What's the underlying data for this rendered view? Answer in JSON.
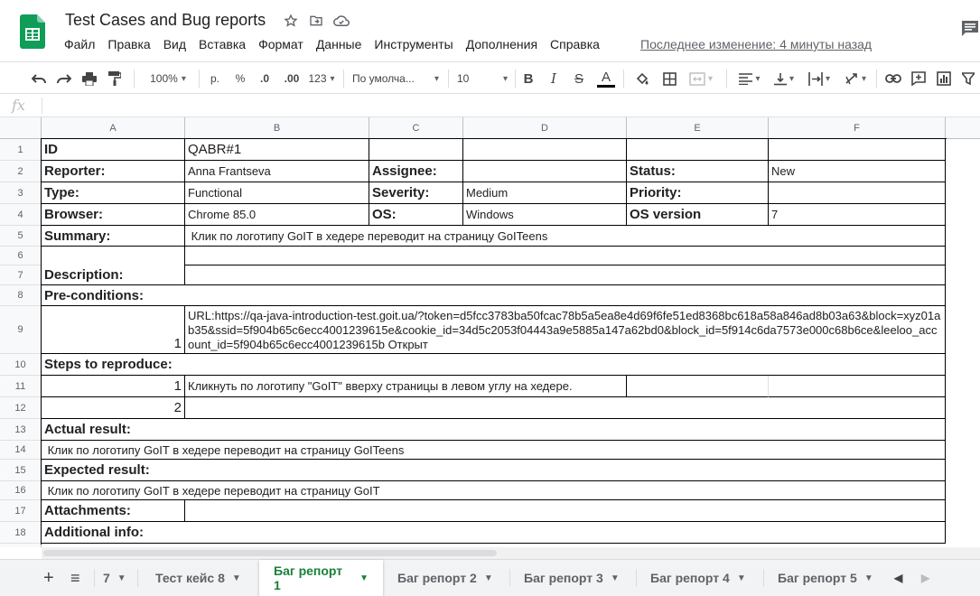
{
  "header": {
    "title": "Test Cases and Bug reports",
    "last_edit": "Последнее изменение: 4 минуты назад",
    "menu": [
      "Файл",
      "Правка",
      "Вид",
      "Вставка",
      "Формат",
      "Данные",
      "Инструменты",
      "Дополнения",
      "Справка"
    ]
  },
  "toolbar": {
    "zoom": "100%",
    "currency": "р.",
    "percent": "%",
    "dec_decrease": ".0",
    "dec_increase": ".00",
    "format_more": "123",
    "font": "По умолча...",
    "font_size": "10",
    "bold": "B",
    "italic": "I",
    "strike": "S",
    "text_color": "A"
  },
  "formula": {
    "fx": "fx",
    "value": ""
  },
  "columns": [
    "A",
    "B",
    "C",
    "D",
    "E",
    "F"
  ],
  "rows": [
    "1",
    "2",
    "3",
    "4",
    "5",
    "6",
    "7",
    "8",
    "9",
    "10",
    "11",
    "12",
    "13",
    "14",
    "15",
    "16",
    "17",
    "18"
  ],
  "cells": {
    "a1": "ID",
    "b1": "QABR#1",
    "a2": "Reporter:",
    "b2": "Anna Frantseva",
    "c2": "Assignee:",
    "e2": "Status:",
    "f2": "New",
    "a3": "Type:",
    "b3": "Functional",
    "c3": "Severity:",
    "d3": "Medium",
    "e3": "Priority:",
    "a4": "Browser:",
    "b4": "Chrome 85.0",
    "c4": "OS:",
    "d4": "Windows",
    "e4": "OS version",
    "f4": "7",
    "a5": "Summary:",
    "b5": " Клик по логотипу GoIT в хедере переводит на страницу GoITeens",
    "a7": "Description:",
    "a8": "Pre-conditions:",
    "a9": "1",
    "b9": "URL:https://qa-java-introduction-test.goit.ua/?token=d5fcc3783ba50fcac78b5a5ea8e4d69f6fe51ed8368bc618a58a846ad8b03a63&block=xyz01ab35&ssid=5f904b65c6ecc4001239615e&cookie_id=34d5c2053f04443a9e5885a147a62bd0&block_id=5f914c6da7573e000c68b6ce&leeloo_account_id=5f904b65c6ecc4001239615b Открыт",
    "a10": "Steps to reproduce:",
    "a11": "1",
    "b11": "Кликнуть по логотипу \"GoIT\" вверху страницы в левом углу на хедере.",
    "a12": "2",
    "a13": "Actual result:",
    "a14": " Клик по логотипу GoIT в хедере переводит на страницу GoITeens",
    "a15": "Expected result:",
    "a16": " Клик по логотипу GoIT в хедере переводит на страницу GoIT",
    "a17": "Attachments:",
    "a18": "Additional info:"
  },
  "sheets": {
    "add": "+",
    "list": "≡",
    "tabs": [
      "7",
      "Тест кейс 8",
      "Баг репорт 1",
      "Баг репорт 2",
      "Баг репорт 3",
      "Баг репорт 4",
      "Баг репорт 5"
    ],
    "active_index": 2
  }
}
